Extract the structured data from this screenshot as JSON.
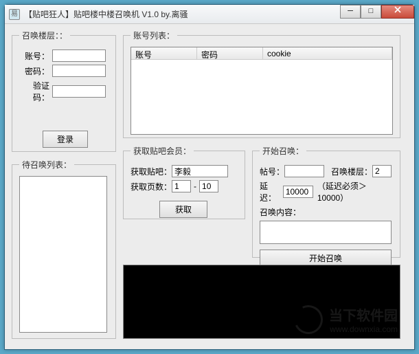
{
  "title": "【贴吧狂人】贴吧楼中楼召唤机 V1.0  by.离骚",
  "groups": {
    "login": {
      "legend": "召唤楼层：：",
      "account_label": "账号：",
      "password_label": "密码：",
      "captcha_label": "验证码：",
      "login_btn": "登录",
      "account_val": "",
      "password_val": "",
      "captcha_val": ""
    },
    "pending": {
      "legend": "待召唤列表："
    },
    "accounts": {
      "legend": "账号列表：",
      "col_account": "账号",
      "col_password": "密码",
      "col_cookie": "cookie"
    },
    "fetch": {
      "legend": "获取贴吧会员：",
      "bar_label": "获取贴吧：",
      "bar_val": "李毅",
      "pages_label": "获取页数：",
      "pages_from": "1",
      "pages_to": "10",
      "dash": "-",
      "fetch_btn": "获取"
    },
    "start": {
      "legend": "开始召唤：",
      "tid_label": "帖号：",
      "tid_val": "",
      "floor_label": "召唤楼层：",
      "floor_val": "2",
      "delay_label": "延迟：",
      "delay_val": "10000",
      "delay_hint": "（延迟必须＞10000）",
      "content_label": "召唤内容：",
      "content_val": "",
      "start_btn": "开始召唤"
    }
  },
  "watermark": {
    "cn": "当下软件园",
    "url": "www.downxia.com"
  }
}
